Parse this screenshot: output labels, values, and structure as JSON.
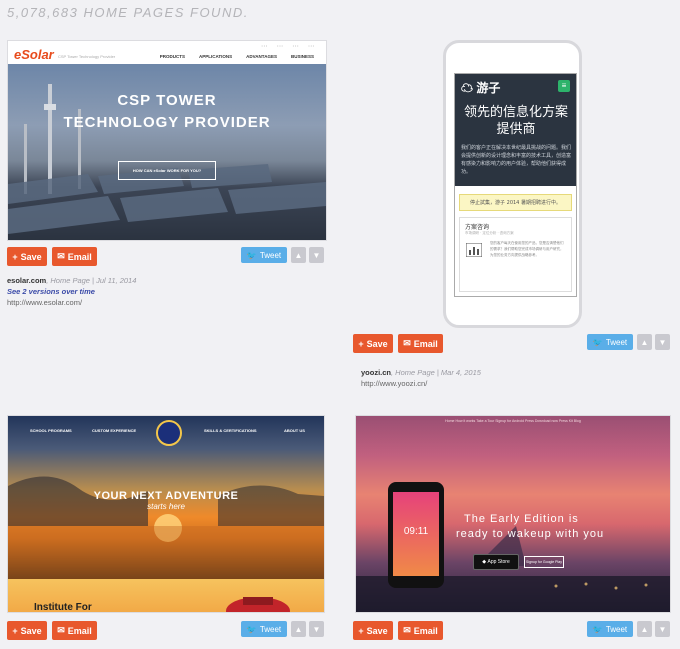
{
  "header": {
    "count_text": "5,078,683 HOME PAGES FOUND."
  },
  "actions": {
    "save": "Save",
    "email": "Email",
    "tweet": "Tweet"
  },
  "cards": [
    {
      "site": "esolar.com",
      "meta": ", Home Page | Jul 11, 2014",
      "versions": "See 2 versions over time",
      "url": "http://www.esolar.com/",
      "preview": {
        "logo": "eSolar",
        "tagline": "CSP Tower Technology Provider",
        "nav": [
          "PRODUCTS",
          "APPLICATIONS",
          "ADVANTAGES",
          "BUSINESS"
        ],
        "hero_line1": "CSP TOWER",
        "hero_line2": "TECHNOLOGY PROVIDER",
        "cta": "HOW CAN eSolar WORK FOR YOU?"
      }
    },
    {
      "site": "yoozi.cn",
      "meta": ", Home Page | Mar 4, 2015",
      "url": "http://www.yoozi.cn/",
      "preview": {
        "logo": "游子",
        "title": "领先的信息化方案提供商",
        "desc": "我们的客户正在解决本世纪最具挑战的问题。我们会提供创新的设计理念和丰富的技术工具，创造富有感染力和影响力的用户体验，帮助他们获得成功。",
        "banner": "停止試集，游子 2014 暑期招聘进行中。",
        "box_title": "方案咨询",
        "box_sub": "市场调研 · 定位分析 · 咨询方案",
        "box_desc": "您的客户每天在使用您的产品，您是否清楚他们的需求？我们帮助您完成市场调研与用户研究，为您的业务方向提供战略参考。"
      }
    },
    {
      "preview": {
        "nav": [
          "SCHOOL PROGRAMS",
          "CUSTOM EXPERIENCE",
          "SKILLS & CERTIFICATIONS",
          "ABOUT US"
        ],
        "title": "YOUR NEXT ADVENTURE",
        "subtitle": "starts here",
        "footer_text": "Institute For"
      }
    },
    {
      "preview": {
        "nav": "Home   How it works   Take a Tour   Signup for Android   Press   Download now   Press Kit   Blog",
        "line1": "The Early Edition is",
        "line2": "ready to wakeup with you",
        "clock": "09:11",
        "store": "App Store",
        "store2": "Signup for Google Play"
      }
    }
  ]
}
